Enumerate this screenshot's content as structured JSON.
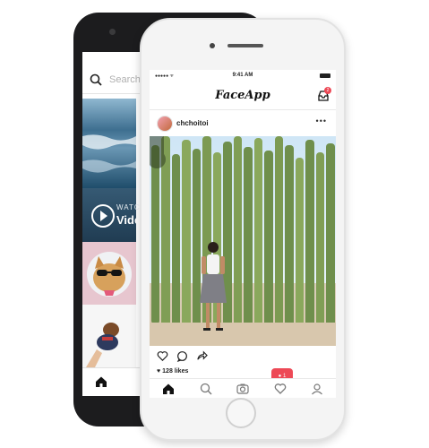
{
  "back_phone": {
    "search_placeholder": "Search",
    "video_overline": "WATCH",
    "video_title": "Video"
  },
  "front_phone": {
    "status": {
      "time": "9:41 AM"
    },
    "app_title": "FaceApp",
    "inbox_badge": "2",
    "post": {
      "username": "chchoitoi",
      "more": "•••",
      "likes": "128 likes"
    },
    "notification_count": "1"
  },
  "colors": {
    "accent_red": "#ed4956",
    "back_phone_body": "#1c1c1e",
    "front_phone_body": "#f4f4f4"
  }
}
